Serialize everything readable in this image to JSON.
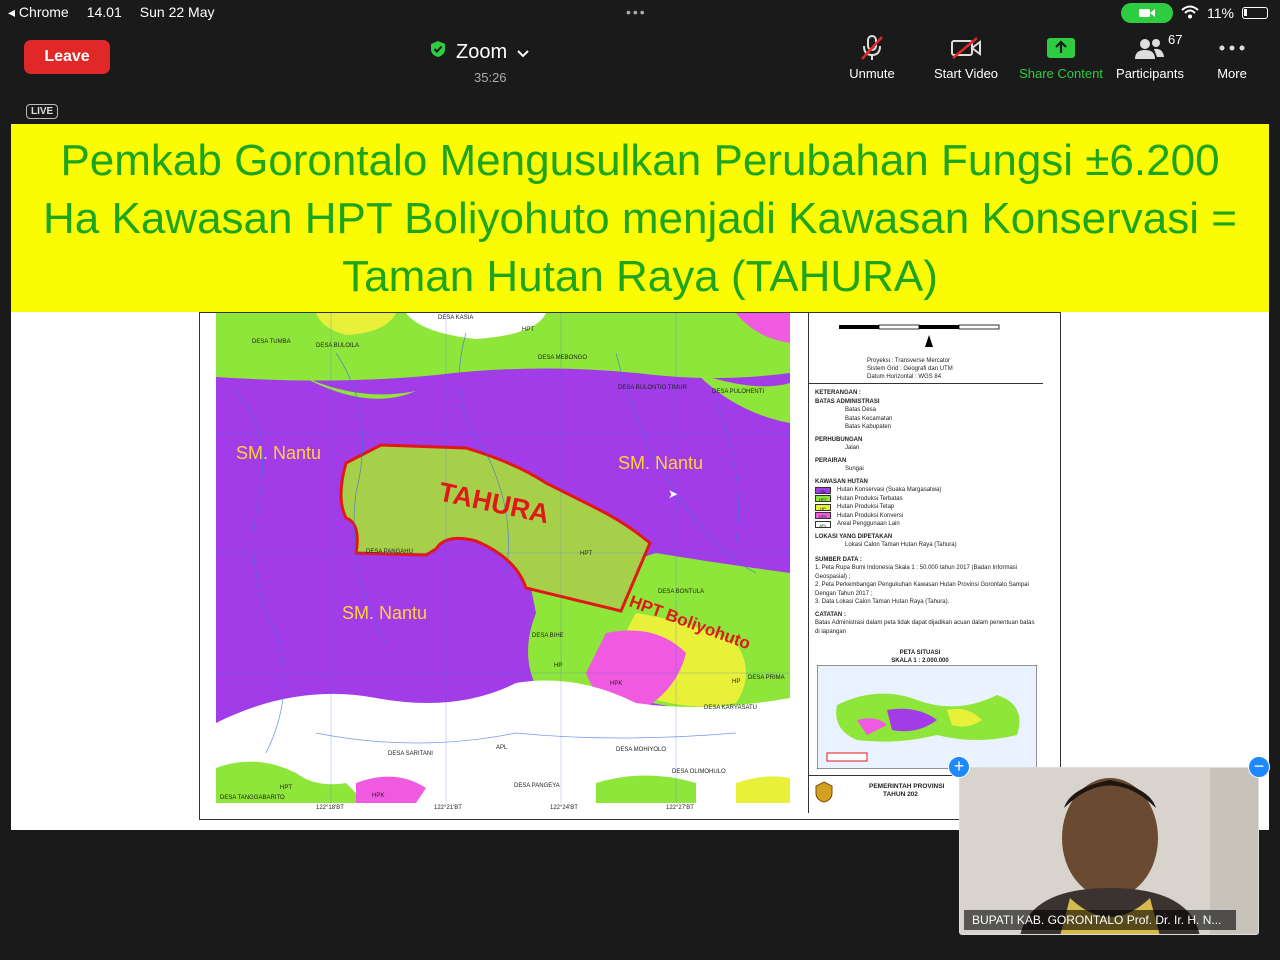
{
  "status_bar": {
    "back_app": "Chrome",
    "time": "14.01",
    "date": "Sun 22 May",
    "battery": "11%"
  },
  "toolbar": {
    "leave_label": "Leave",
    "meeting_title": "Zoom",
    "elapsed": "35:26",
    "unmute_label": "Unmute",
    "start_video_label": "Start Video",
    "share_label": "Share Content",
    "participants_label": "Participants",
    "participants_count": "67",
    "more_label": "More"
  },
  "live_badge": "LIVE",
  "slide": {
    "title_lines": [
      "Pemkab Gorontalo Mengusulkan Perubahan Fungsi ±6.200",
      "Ha Kawasan HPT Boliyohuto menjadi Kawasan Konservasi =",
      "Taman Hutan Raya (TAHURA)"
    ],
    "map": {
      "labels": {
        "sm_nantu_1": "SM. Nantu",
        "sm_nantu_2": "SM. Nantu",
        "sm_nantu_3": "SM. Nantu",
        "tahura": "TAHURA",
        "hpt_boliyohuto": "HPT Boliyohuto"
      },
      "villages": [
        "DESA TUMBA",
        "DESA BULOILA",
        "DESA KASIA",
        "DESA MEBONGO",
        "DESA BULONTIO TIMUR",
        "DESA PULOHENTI",
        "DESA PANGAHU",
        "DESA BONTULA",
        "DESA BIHE",
        "DESA PRIMA",
        "DESA KARYASATU",
        "DESA SARITANI",
        "DESA MOHIYOLO",
        "DESA OLIMOHULO",
        "DESA PANGEYA",
        "DESA TANGGABARITO"
      ],
      "zone_tags": [
        "HPT",
        "HPT",
        "HP",
        "HP",
        "HPK",
        "HPK",
        "APL",
        "HPT"
      ],
      "lon_ticks": [
        "122°18'BT",
        "122°21'BT",
        "122°24'BT",
        "122°27'BT"
      ]
    },
    "legend": {
      "projection_rows": [
        "Proyeksi : Transverse Mercator",
        "Sistem Grid : Geografi dan UTM",
        "Datum Horizontal : WGS 84"
      ],
      "keterangan": "KETERANGAN :",
      "batas_admin": "BATAS ADMINISTRASI",
      "batas_items": [
        "Batas Desa",
        "Batas Kecamatan",
        "Batas Kabupaten"
      ],
      "perhubungan": "PERHUBUNGAN",
      "jalan": "Jalan",
      "perairan": "PERAIRAN",
      "sungai": "Sungai",
      "kawasan_hutan": "KAWASAN HUTAN",
      "kawasan_items": [
        {
          "code": "SM",
          "label": "Hutan Konservasi (Suaka Margasatwa)",
          "color": "#a23be8"
        },
        {
          "code": "HPT",
          "label": "Hutan Produksi Terbatas",
          "color": "#8ee63a"
        },
        {
          "code": "HP",
          "label": "Hutan Produksi Tetap",
          "color": "#e8f03a"
        },
        {
          "code": "HPK",
          "label": "Hutan Produksi Konversi",
          "color": "#f05ae0"
        },
        {
          "code": "APL",
          "label": "Areal Penggunaan Lain",
          "color": "#ffffff"
        }
      ],
      "lokasi_title": "LOKASI YANG DIPETAKAN",
      "lokasi_item": "Lokasi Calon Taman Hutan Raya (Tahura)",
      "sumber_title": "SUMBER DATA :",
      "sumber_items": [
        "1. Peta Rupa Bumi Indonesia Skala 1 : 50.000 tahun 2017 (Badan Informasi Geospasial) ;",
        "2. Peta Perkembangan Pengukuhan Kawasan Hutan Provinsi Gorontalo Sampai Dengan Tahun 2017 ;",
        "3. Data Lokasi Calon Taman Hutan Raya (Tahura)."
      ],
      "catatan_title": "CATATAN :",
      "catatan_text": "Batas Administrasi dalam peta tidak dapat dijadikan acuan dalam penentuan batas di lapangan",
      "situasi_title": "PETA SITUASI",
      "situasi_scale": "SKALA 1 : 2.000.000",
      "pemerintah": "PEMERINTAH PROVINSI",
      "tahun": "TAHUN 202"
    }
  },
  "video_tile": {
    "name": "BUPATI KAB. GORONTALO  Prof. Dr. Ir. H. N..."
  },
  "colors": {
    "accent_green": "#1ea51e",
    "banner_yellow": "#fbfb04",
    "leave_red": "#e02828",
    "share_green": "#2ecc40",
    "tahura_red": "#e01818"
  }
}
